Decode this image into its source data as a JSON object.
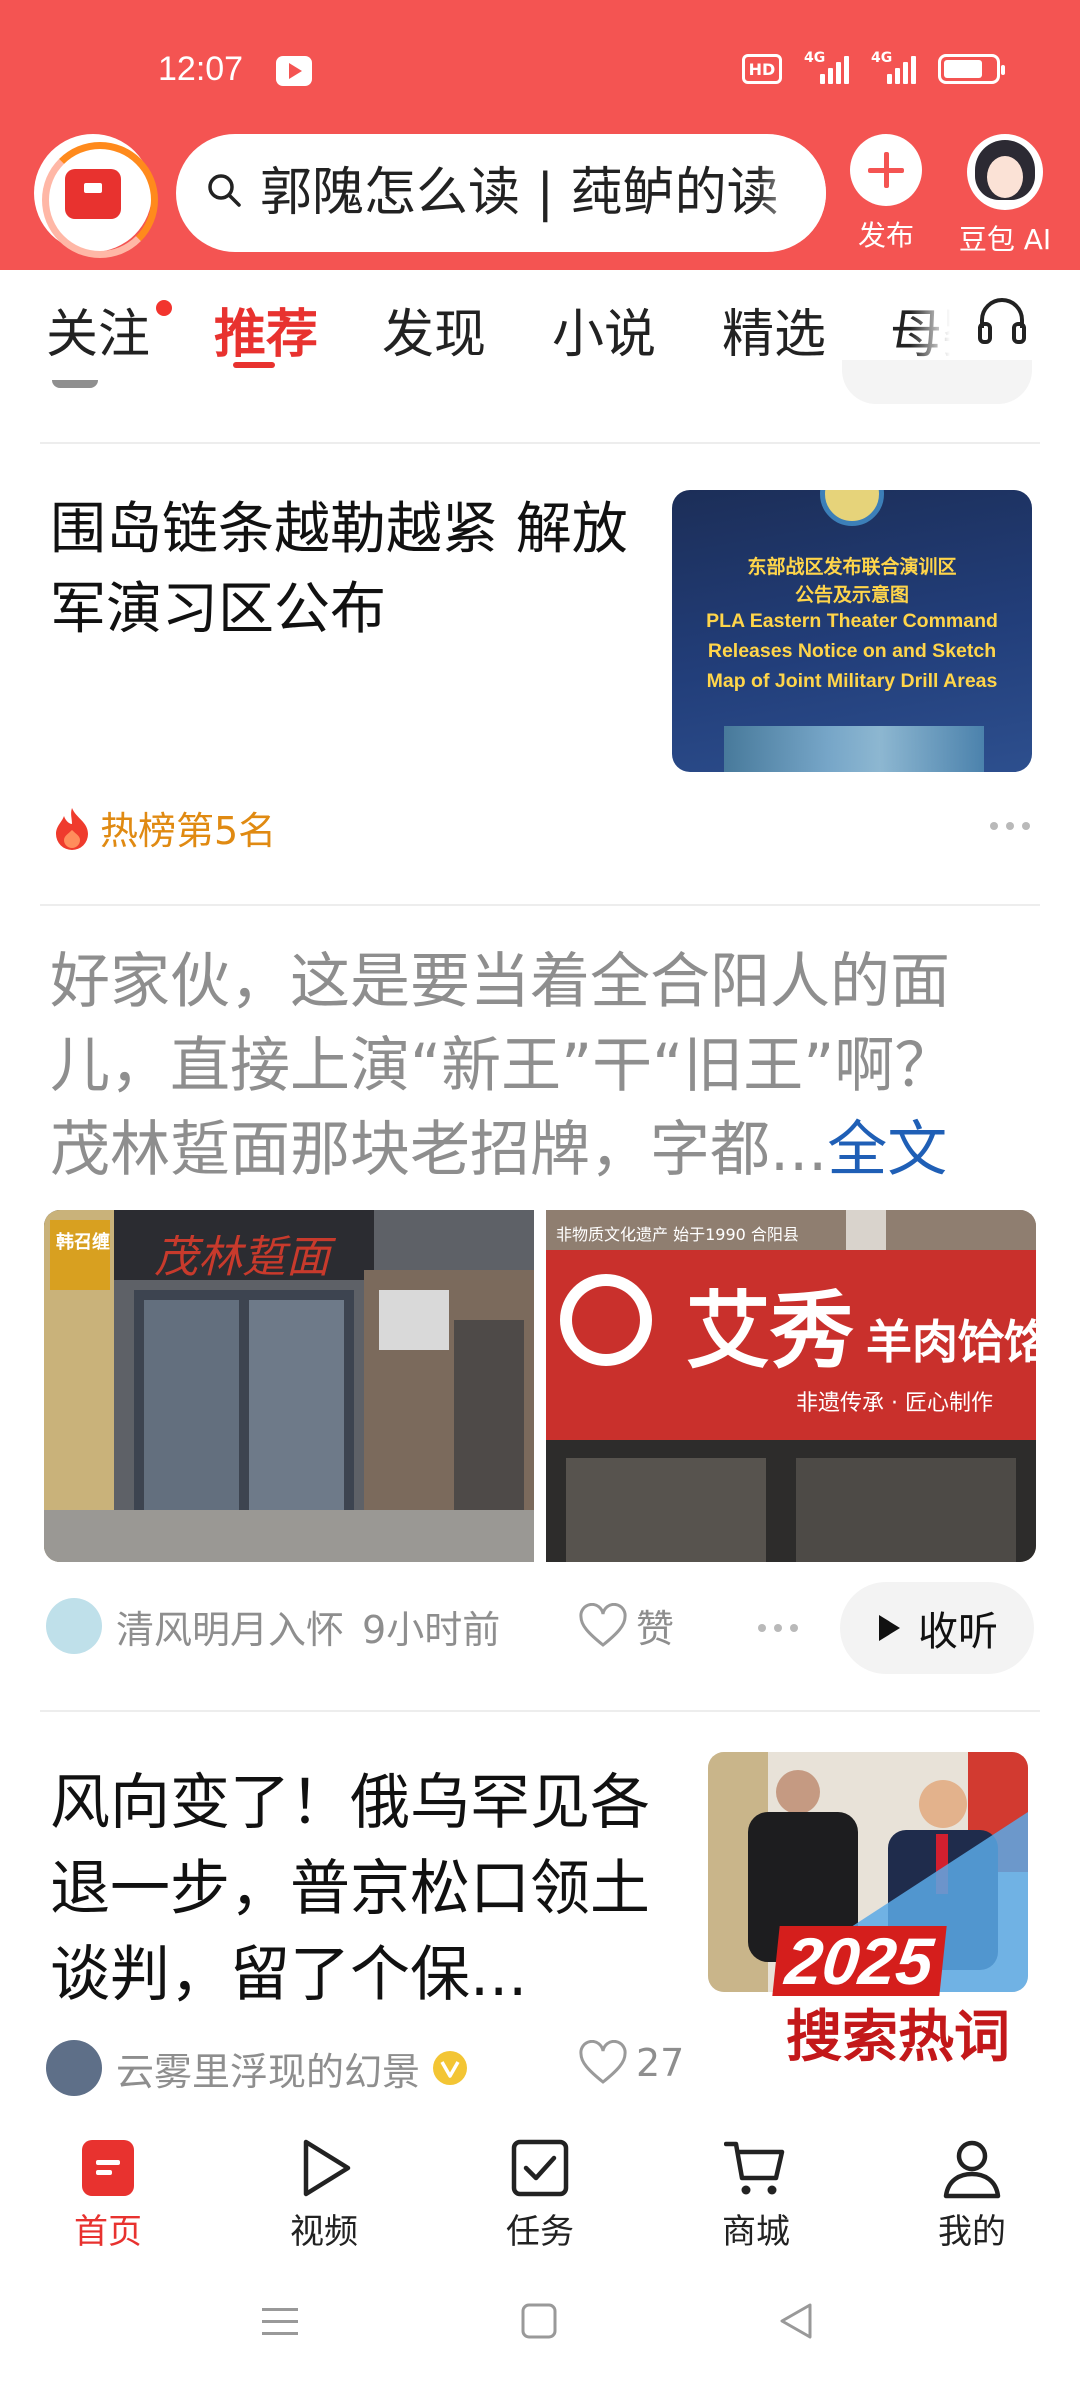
{
  "status_bar": {
    "time": "12:07",
    "hd": "HD",
    "network_1": "4G",
    "network_2": "4G"
  },
  "header": {
    "search_text": "郭隗怎么读 | 莼鲈的读",
    "publish_label": "发布",
    "ai_label": "豆包 AI"
  },
  "tabs": [
    {
      "label": "关注"
    },
    {
      "label": "推荐"
    },
    {
      "label": "发现"
    },
    {
      "label": "小说"
    },
    {
      "label": "精选"
    },
    {
      "label": "母婴"
    }
  ],
  "active_tab": "推荐",
  "articles": {
    "a1": {
      "title": "围岛链条越勒越紧 解放军演习区公布",
      "thumb_cn_1": "东部战区发布联合演训区",
      "thumb_cn_2": "公告及示意图",
      "thumb_en_1": "PLA Eastern Theater Command",
      "thumb_en_2": "Releases Notice on and Sketch",
      "thumb_en_3": "Map of Joint Military Drill Areas",
      "hot_label": "热榜第5名"
    },
    "a2": {
      "line_1": "好家伙，这是要当着全合阳人的面",
      "line_2": "儿，直接上演“新王”干“旧王”啊？",
      "line_3": "茂林踅面那块老招牌，字都...",
      "full_text": "全文",
      "img1_sign": "茂林踅面",
      "img1_side": "韩召缠 措牛肉",
      "img2_sign": "艾秀",
      "img2_sign_sub": "羊肉饸饹",
      "img2_small": "非遗传承 · 匠心制作",
      "img2_top": "非物质文化遗产  始于1990 合阳县",
      "author": "清风明月入怀",
      "time": "9小时前",
      "like_label": "赞",
      "listen_label": "收听"
    },
    "a3": {
      "title": "风向变了！俄乌罕见各退一步，普京松口领土谈判，留了个保...",
      "author": "云雾里浮现的幻景",
      "likes": "27",
      "badge_year": "2025",
      "badge_text": "搜索热词"
    }
  },
  "bottom_nav": [
    {
      "label": "首页",
      "icon": "home-icon"
    },
    {
      "label": "视频",
      "icon": "video-play-icon"
    },
    {
      "label": "任务",
      "icon": "task-check-icon"
    },
    {
      "label": "商城",
      "icon": "cart-icon"
    },
    {
      "label": "我的",
      "icon": "profile-icon"
    }
  ],
  "colors": {
    "brand_red": "#f45452",
    "active_red": "#e8322f",
    "hot_orange": "#e08a12",
    "link_blue": "#1f5fb6"
  }
}
